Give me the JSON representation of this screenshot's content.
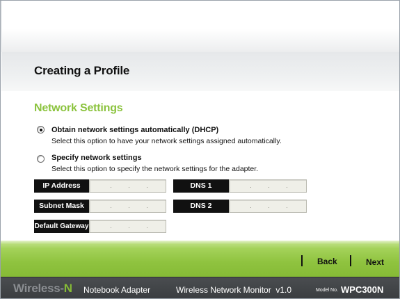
{
  "page": {
    "title": "Creating a Profile"
  },
  "section": {
    "title": "Network Settings"
  },
  "options": [
    {
      "label": "Obtain network settings automatically (DHCP)",
      "description": "Select this option to have your network settings assigned automatically.",
      "selected": true
    },
    {
      "label": "Specify network settings",
      "description": "Select this option to specify the network settings for the adapter.",
      "selected": false
    }
  ],
  "fields": {
    "ip_address": {
      "label": "IP Address",
      "value": ""
    },
    "subnet_mask": {
      "label": "Subnet Mask",
      "value": ""
    },
    "default_gateway": {
      "label": "Default Gateway",
      "value": ""
    },
    "dns1": {
      "label": "DNS 1",
      "value": ""
    },
    "dns2": {
      "label": "DNS 2",
      "value": ""
    }
  },
  "nav": {
    "back_label": "Back",
    "next_label": "Next"
  },
  "footer": {
    "brand_prefix": "Wireless-",
    "brand_suffix": "N",
    "product": "Notebook Adapter",
    "app_name": "Wireless Network Monitor  v1.0",
    "model_label": "Model No.",
    "model_value": "WPC300N"
  },
  "colors": {
    "accent_green": "#8bc33d",
    "footer_bg": "#3a3d40",
    "label_bg": "#111111",
    "input_bg": "#efefe8"
  },
  "icons": {
    "radio_selected": "radio-checked-icon",
    "radio_unselected": "radio-unchecked-icon"
  }
}
